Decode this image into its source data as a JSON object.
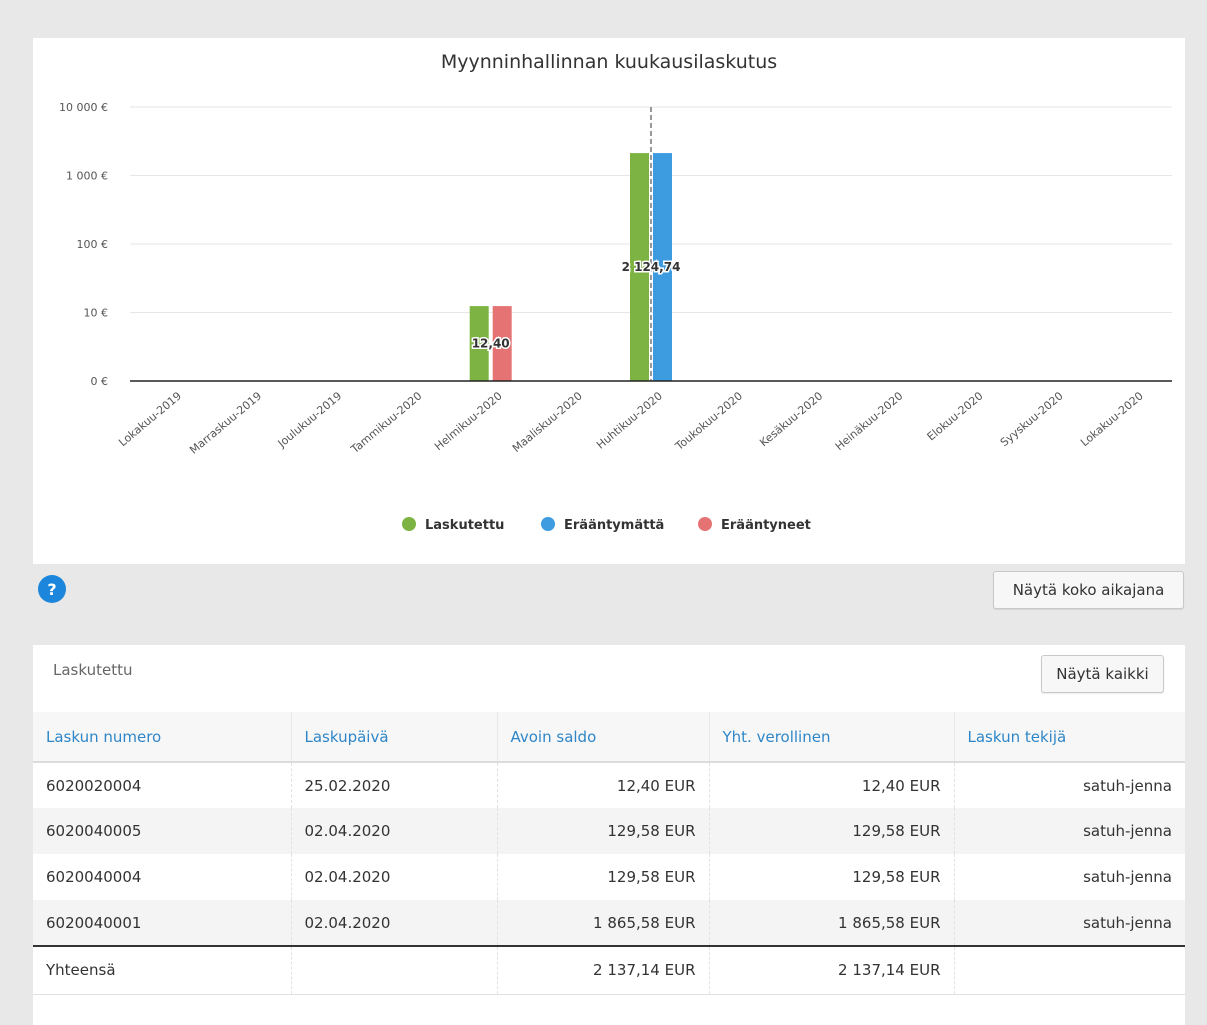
{
  "chart": {
    "title": "Myynninhallinnan kuukausilaskutus",
    "y_ticks": [
      "10 000 €",
      "1 000 €",
      "100 €",
      "10 €",
      "0 €"
    ],
    "legend": [
      {
        "label": "Laskutettu",
        "color": "#7cb342"
      },
      {
        "label": "Erääntymättä",
        "color": "#3d9be0"
      },
      {
        "label": "Erääntyneet",
        "color": "#e57373"
      }
    ],
    "data_labels": [
      "12,40",
      "2 124,74"
    ]
  },
  "chart_data": {
    "type": "bar",
    "title": "Myynninhallinnan kuukausilaskutus",
    "y_scale": "log",
    "ylim": [
      0,
      10000
    ],
    "categories": [
      "Lokakuu-2019",
      "Marraskuu-2019",
      "Joulukuu-2019",
      "Tammikuu-2020",
      "Helmikuu-2020",
      "Maaliskuu-2020",
      "Huhtikuu-2020",
      "Toukokuu-2020",
      "Kesäkuu-2020",
      "Heinäkuu-2020",
      "Elokuu-2020",
      "Syyskuu-2020",
      "Lokakuu-2020"
    ],
    "series": [
      {
        "name": "Laskutettu",
        "color": "#7cb342",
        "values": [
          0,
          0,
          0,
          0,
          12.4,
          0,
          2124.74,
          0,
          0,
          0,
          0,
          0,
          0
        ]
      },
      {
        "name": "Erääntymättä",
        "color": "#3d9be0",
        "values": [
          0,
          0,
          0,
          0,
          0,
          0,
          2124.74,
          0,
          0,
          0,
          0,
          0,
          0
        ]
      },
      {
        "name": "Erääntyneet",
        "color": "#e57373",
        "values": [
          0,
          0,
          0,
          0,
          12.4,
          0,
          0,
          0,
          0,
          0,
          0,
          0,
          0
        ]
      }
    ],
    "current_month_marker": "Huhtikuu-2020",
    "grid": true,
    "legend_position": "bottom"
  },
  "help_label": "?",
  "timeline_button": "Näytä koko aikajana",
  "table": {
    "title": "Laskutettu",
    "show_all_button": "Näytä kaikki",
    "headers": [
      "Laskun numero",
      "Laskupäivä",
      "Avoin saldo",
      "Yht. verollinen",
      "Laskun tekijä"
    ],
    "rows": [
      [
        "6020020004",
        "25.02.2020",
        "12,40 EUR",
        "12,40 EUR",
        "satuh-jenna"
      ],
      [
        "6020040005",
        "02.04.2020",
        "129,58 EUR",
        "129,58 EUR",
        "satuh-jenna"
      ],
      [
        "6020040004",
        "02.04.2020",
        "129,58 EUR",
        "129,58 EUR",
        "satuh-jenna"
      ],
      [
        "6020040001",
        "02.04.2020",
        "1 865,58 EUR",
        "1 865,58 EUR",
        "satuh-jenna"
      ]
    ],
    "footer": [
      "Yhteensä",
      "",
      "2 137,14 EUR",
      "2 137,14 EUR",
      ""
    ]
  }
}
